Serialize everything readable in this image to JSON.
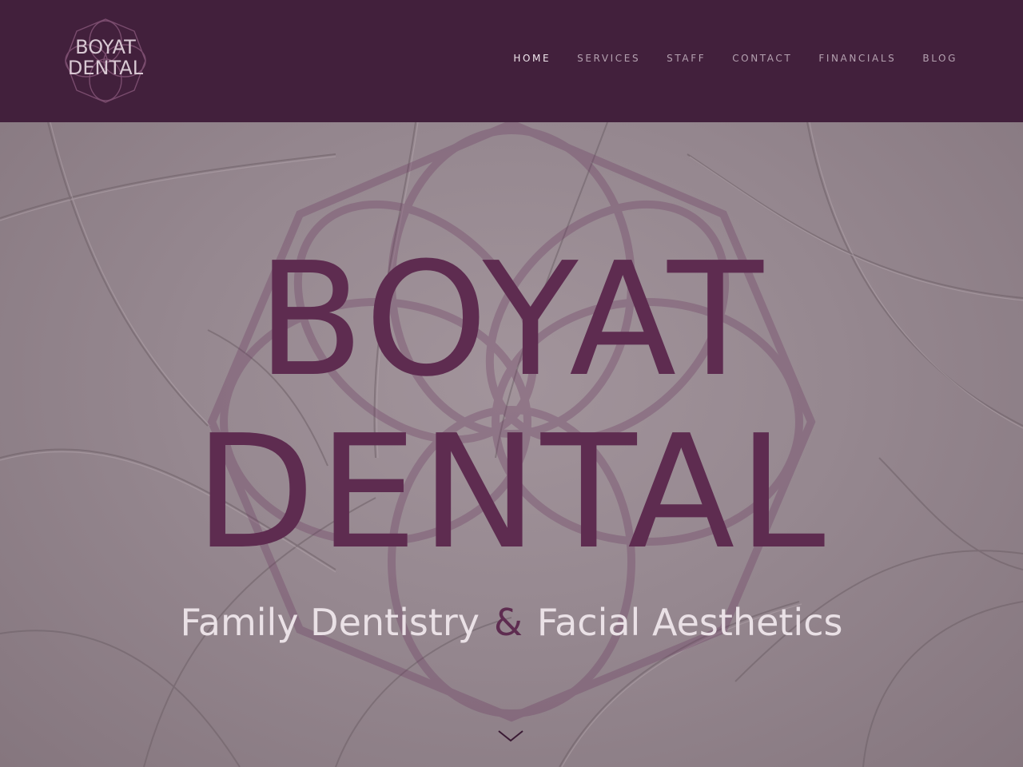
{
  "header": {
    "logo": {
      "line1": "BOYAT",
      "line2": "DENTAL"
    },
    "nav": [
      {
        "label": "HOME",
        "active": true
      },
      {
        "label": "SERVICES",
        "active": false
      },
      {
        "label": "STAFF",
        "active": false
      },
      {
        "label": "CONTACT",
        "active": false
      },
      {
        "label": "FINANCIALS",
        "active": false
      },
      {
        "label": "BLOG",
        "active": false
      }
    ]
  },
  "hero": {
    "title_line1": "BOYAT",
    "title_line2": "DENTAL",
    "tagline_part1": "Family Dentistry",
    "tagline_amp": "&",
    "tagline_part2": "Facial Aesthetics",
    "scroll_icon": "chevron-down-icon"
  },
  "colors": {
    "header_bg": "#42203c",
    "brand_plum": "#5e2c50",
    "nav_text": "#b4a1b0",
    "nav_active": "#f1e8ee",
    "tagline": "#eae1e6"
  }
}
